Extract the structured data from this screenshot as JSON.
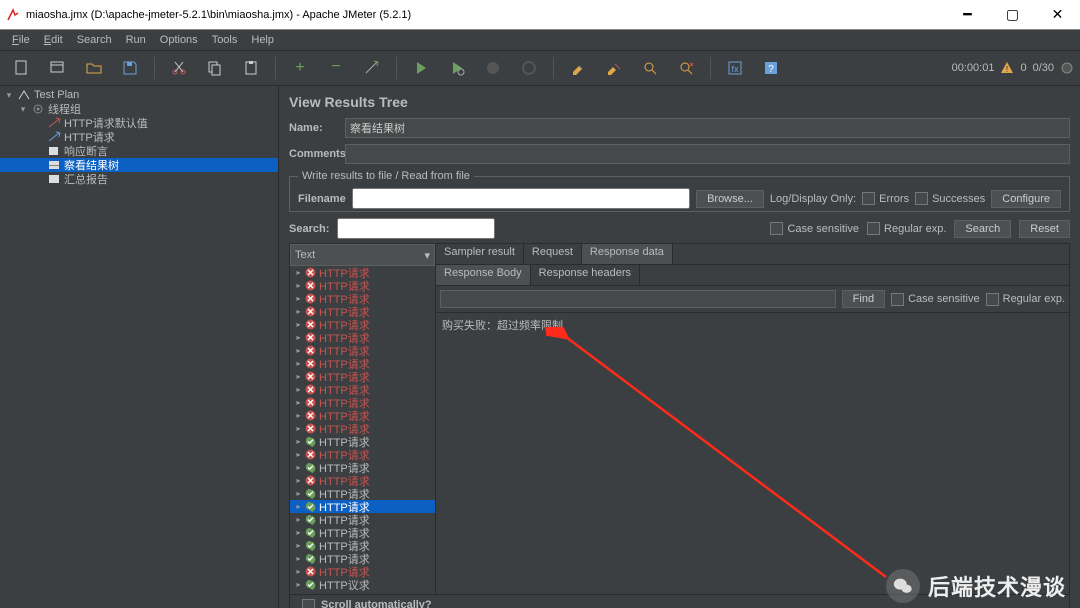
{
  "window": {
    "title": "miaosha.jmx (D:\\apache-jmeter-5.2.1\\bin\\miaosha.jmx) - Apache JMeter (5.2.1)"
  },
  "menu": {
    "file": "File",
    "edit": "Edit",
    "search": "Search",
    "run": "Run",
    "options": "Options",
    "tools": "Tools",
    "help": "Help"
  },
  "status": {
    "elapsed": "00:00:01",
    "warn": "0",
    "threads": "0/30"
  },
  "tree": {
    "testplan": "Test Plan",
    "threadgroup": "线程组",
    "httpdef": "HTTP请求默认值",
    "httpreq": "HTTP请求",
    "assert": "响应断言",
    "results": "察看结果树",
    "summary": "汇总报告"
  },
  "view": {
    "title": "View Results Tree",
    "name_label": "Name:",
    "name_value": "察看结果树",
    "comments_label": "Comments:",
    "fieldset": "Write results to file / Read from file",
    "filename_label": "Filename",
    "browse": "Browse...",
    "logonly": "Log/Display Only:",
    "errors": "Errors",
    "successes": "Successes",
    "configure": "Configure",
    "search_label": "Search:",
    "case_sensitive": "Case sensitive",
    "regexp": "Regular exp.",
    "search_btn": "Search",
    "reset_btn": "Reset",
    "combo": "Text",
    "tabs": {
      "sampler": "Sampler result",
      "request": "Request",
      "response": "Response data"
    },
    "subtabs": {
      "body": "Response Body",
      "headers": "Response headers"
    },
    "find": "Find",
    "scrollauto": "Scroll automatically?"
  },
  "response": {
    "body": "购买失败：超过频率限制"
  },
  "results": [
    {
      "s": "fail",
      "label": "HTTP请求"
    },
    {
      "s": "fail",
      "label": "HTTP请求"
    },
    {
      "s": "fail",
      "label": "HTTP请求"
    },
    {
      "s": "fail",
      "label": "HTTP请求"
    },
    {
      "s": "fail",
      "label": "HTTP请求"
    },
    {
      "s": "fail",
      "label": "HTTP请求"
    },
    {
      "s": "fail",
      "label": "HTTP请求"
    },
    {
      "s": "fail",
      "label": "HTTP请求"
    },
    {
      "s": "fail",
      "label": "HTTP请求"
    },
    {
      "s": "fail",
      "label": "HTTP请求"
    },
    {
      "s": "fail",
      "label": "HTTP请求"
    },
    {
      "s": "fail",
      "label": "HTTP请求"
    },
    {
      "s": "fail",
      "label": "HTTP请求"
    },
    {
      "s": "pass",
      "label": "HTTP请求"
    },
    {
      "s": "fail",
      "label": "HTTP请求"
    },
    {
      "s": "pass",
      "label": "HTTP请求"
    },
    {
      "s": "fail",
      "label": "HTTP请求"
    },
    {
      "s": "pass",
      "label": "HTTP请求"
    },
    {
      "s": "pass",
      "label": "HTTP请求",
      "sel": true
    },
    {
      "s": "pass",
      "label": "HTTP请求"
    },
    {
      "s": "pass",
      "label": "HTTP请求"
    },
    {
      "s": "pass",
      "label": "HTTP请求"
    },
    {
      "s": "pass",
      "label": "HTTP请求"
    },
    {
      "s": "fail",
      "label": "HTTP请求"
    },
    {
      "s": "pass",
      "label": "HTTP议求"
    }
  ],
  "watermark": "后端技术漫谈"
}
